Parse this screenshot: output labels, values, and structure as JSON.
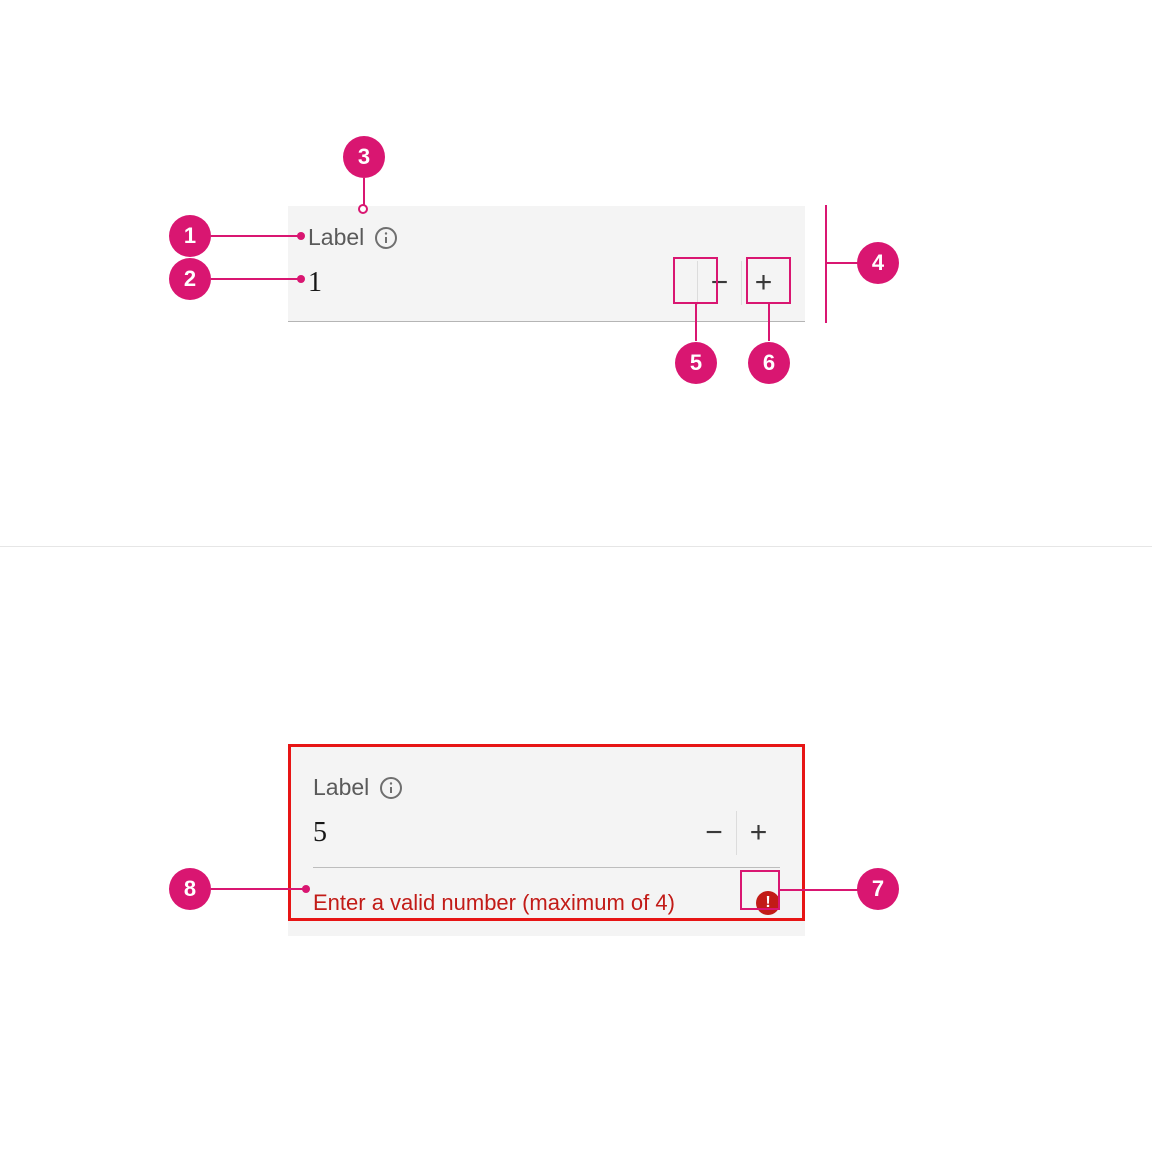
{
  "colors": {
    "accent": "#d91671",
    "error": "#c21b17",
    "fieldBg": "#f4f4f4",
    "textMuted": "#5a5a5a"
  },
  "stepper1": {
    "label": "Label",
    "value": "1",
    "info_icon": "info-icon",
    "minus_label": "−",
    "plus_label": "+"
  },
  "stepper2": {
    "label": "Label",
    "value": "5",
    "info_icon": "info-icon",
    "minus_label": "−",
    "plus_label": "+",
    "error_message": "Enter a valid number (maximum of 4)",
    "error_icon_glyph": "!"
  },
  "callouts": {
    "c1": "1",
    "c2": "2",
    "c3": "3",
    "c4": "4",
    "c5": "5",
    "c6": "6",
    "c7": "7",
    "c8": "8"
  }
}
